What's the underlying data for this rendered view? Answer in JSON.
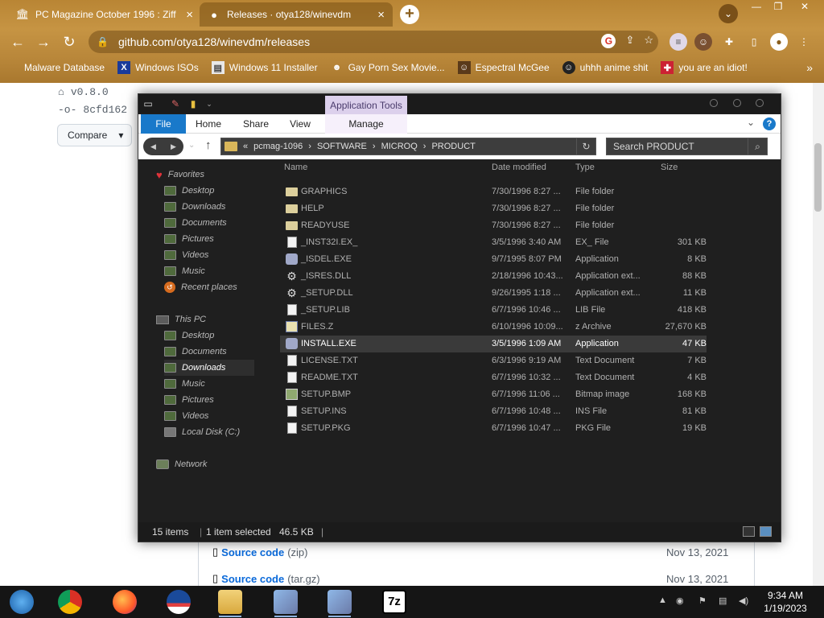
{
  "browser": {
    "tabs": [
      {
        "title": "PC Magazine October 1996 : Ziff",
        "icon": "archive-icon"
      },
      {
        "title": "Releases · otya128/winevdm",
        "icon": "github-icon"
      }
    ],
    "url": "github.com/otya128/winevdm/releases",
    "bookmarks": [
      {
        "label": "Malware Database",
        "icon": "bookmark-icon"
      },
      {
        "label": "Windows ISOs",
        "icon": "x-icon"
      },
      {
        "label": "Windows 11 Installer",
        "icon": "folder-icon"
      },
      {
        "label": "Gay Porn Sex Movie...",
        "icon": "user-icon"
      },
      {
        "label": "Espectral McGee",
        "icon": "mask-icon"
      },
      {
        "label": "uhhh anime shit",
        "icon": "anime-icon"
      },
      {
        "label": "you are an idiot!",
        "icon": "flag-icon"
      }
    ],
    "more_bookmarks": "»"
  },
  "github": {
    "tag": "v0.8.0",
    "commit": "8cfd162",
    "compare_label": "Compare",
    "assets": [
      {
        "name": "Source code",
        "type": "(zip)",
        "date": "Nov 13, 2021"
      },
      {
        "name": "Source code",
        "type": "(tar.gz)",
        "date": "Nov 13, 2021"
      }
    ]
  },
  "explorer": {
    "contextual_tab": "Application Tools",
    "ribbon_tabs": [
      "File",
      "Home",
      "Share",
      "View",
      "Manage"
    ],
    "breadcrumb": [
      "«",
      "pcmag-1096",
      "SOFTWARE",
      "MICROQ",
      "PRODUCT"
    ],
    "search_placeholder": "Search PRODUCT",
    "nav": {
      "favorites": "Favorites",
      "favorites_items": [
        "Desktop",
        "Downloads",
        "Documents",
        "Pictures",
        "Videos",
        "Music",
        "Recent places"
      ],
      "this_pc": "This PC",
      "this_pc_items": [
        "Desktop",
        "Documents",
        "Downloads",
        "Music",
        "Pictures",
        "Videos",
        "Local Disk (C:)"
      ],
      "network": "Network",
      "selected": "Downloads"
    },
    "columns": {
      "name": "Name",
      "date": "Date modified",
      "type": "Type",
      "size": "Size"
    },
    "files": [
      {
        "name": "GRAPHICS",
        "date": "7/30/1996 8:27 ...",
        "type": "File folder",
        "size": "",
        "icon": "folder"
      },
      {
        "name": "HELP",
        "date": "7/30/1996 8:27 ...",
        "type": "File folder",
        "size": "",
        "icon": "folder"
      },
      {
        "name": "READYUSE",
        "date": "7/30/1996 8:27 ...",
        "type": "File folder",
        "size": "",
        "icon": "folder"
      },
      {
        "name": "_INST32I.EX_",
        "date": "3/5/1996 3:40 AM",
        "type": "EX_ File",
        "size": "301 KB",
        "icon": "doc"
      },
      {
        "name": "_ISDEL.EXE",
        "date": "9/7/1995 8:07 PM",
        "type": "Application",
        "size": "8 KB",
        "icon": "app"
      },
      {
        "name": "_ISRES.DLL",
        "date": "2/18/1996 10:43...",
        "type": "Application ext...",
        "size": "88 KB",
        "icon": "gear"
      },
      {
        "name": "_SETUP.DLL",
        "date": "9/26/1995 1:18 ...",
        "type": "Application ext...",
        "size": "11 KB",
        "icon": "gear"
      },
      {
        "name": "_SETUP.LIB",
        "date": "6/7/1996 10:46 ...",
        "type": "LIB File",
        "size": "418 KB",
        "icon": "doc"
      },
      {
        "name": "FILES.Z",
        "date": "6/10/1996 10:09...",
        "type": "z Archive",
        "size": "27,670 KB",
        "icon": "arch"
      },
      {
        "name": "INSTALL.EXE",
        "date": "3/5/1996 1:09 AM",
        "type": "Application",
        "size": "47 KB",
        "icon": "app",
        "selected": true
      },
      {
        "name": "LICENSE.TXT",
        "date": "6/3/1996 9:19 AM",
        "type": "Text Document",
        "size": "7 KB",
        "icon": "doc"
      },
      {
        "name": "README.TXT",
        "date": "6/7/1996 10:32 ...",
        "type": "Text Document",
        "size": "4 KB",
        "icon": "doc"
      },
      {
        "name": "SETUP.BMP",
        "date": "6/7/1996 11:06 ...",
        "type": "Bitmap image",
        "size": "168 KB",
        "icon": "bmp"
      },
      {
        "name": "SETUP.INS",
        "date": "6/7/1996 10:48 ...",
        "type": "INS File",
        "size": "81 KB",
        "icon": "doc"
      },
      {
        "name": "SETUP.PKG",
        "date": "6/7/1996 10:47 ...",
        "type": "PKG File",
        "size": "19 KB",
        "icon": "doc"
      }
    ],
    "status": {
      "count": "15 items",
      "selected": "1 item selected",
      "size": "46.5 KB"
    }
  },
  "taskbar": {
    "apps": [
      "start-orb-icon",
      "chrome-icon",
      "firefox-icon",
      "obama-icon",
      "file-explorer-icon",
      "installer-icon",
      "installer-icon",
      "7zip-icon"
    ],
    "zip_label": "7z",
    "time": "9:34 AM",
    "date": "1/19/2023"
  }
}
